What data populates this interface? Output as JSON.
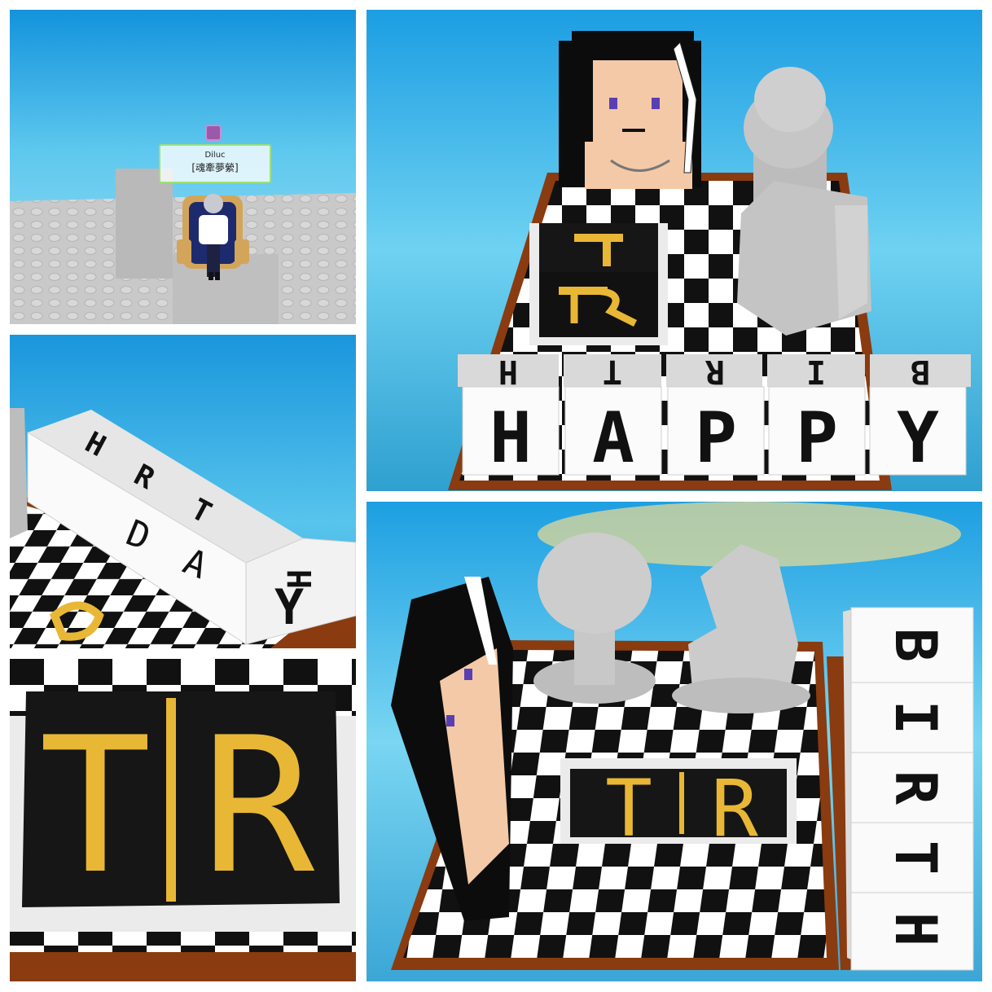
{
  "panels": [
    {
      "id": "panel-character-on-platform"
    },
    {
      "id": "panel-board-happy-front"
    },
    {
      "id": "panel-birthday-blocks-side"
    },
    {
      "id": "panel-tr-closeup"
    },
    {
      "id": "panel-board-birth-side"
    }
  ],
  "player": {
    "name": "Diluc",
    "title": "[魂牽夢縈]",
    "icon": "player-badge-icon"
  },
  "blocks": {
    "front_row": [
      "H",
      "A",
      "P",
      "P",
      "Y"
    ],
    "side_row_short": [
      "H",
      "T",
      "R",
      "I",
      "B"
    ],
    "bday_row": [
      "D",
      "A",
      "Y"
    ],
    "side_row_long": [
      "B",
      "I",
      "R",
      "T",
      "H"
    ]
  },
  "plaque": {
    "letters": [
      "T",
      "R"
    ],
    "letter_color": "#e8b735",
    "background_color": "#161616"
  },
  "colors": {
    "sky_top": "#1a9be0",
    "sky_bottom": "#68d0f0",
    "board_frame": "#8a3b10",
    "board_dark": "#111111",
    "board_light": "#ffffff",
    "stone": "#bdbdbd",
    "hair": "#0c0c0c",
    "skin": "#f4c9a7"
  }
}
